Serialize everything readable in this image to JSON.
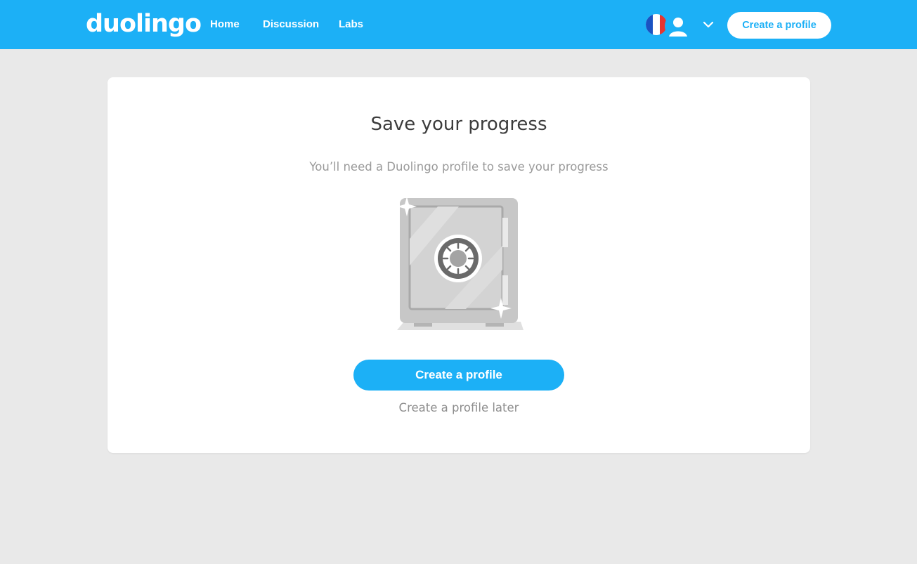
{
  "app": {
    "logo_text": "duolingo",
    "brand_color": "#1cb0f6"
  },
  "header": {
    "nav": [
      {
        "label": "Home"
      },
      {
        "label": "Discussion"
      },
      {
        "label": "Labs"
      }
    ],
    "language_flag": "france-flag-icon",
    "profile_icon": "user-avatar-icon",
    "dropdown_icon": "chevron-down-icon",
    "create_profile_label": "Create a profile"
  },
  "dialog": {
    "title": "Save your progress",
    "subtitle": "You’ll need a Duolingo profile to save your progress",
    "illustration": "safe-illustration",
    "primary_button_label": "Create a profile",
    "secondary_link_label": "Create a profile later"
  },
  "colors": {
    "header_bg": "#1cb0f6",
    "page_bg": "#e9e9e9",
    "card_bg": "#ffffff",
    "title_text": "#3c3c3c",
    "muted_text": "#9a9a9a"
  }
}
